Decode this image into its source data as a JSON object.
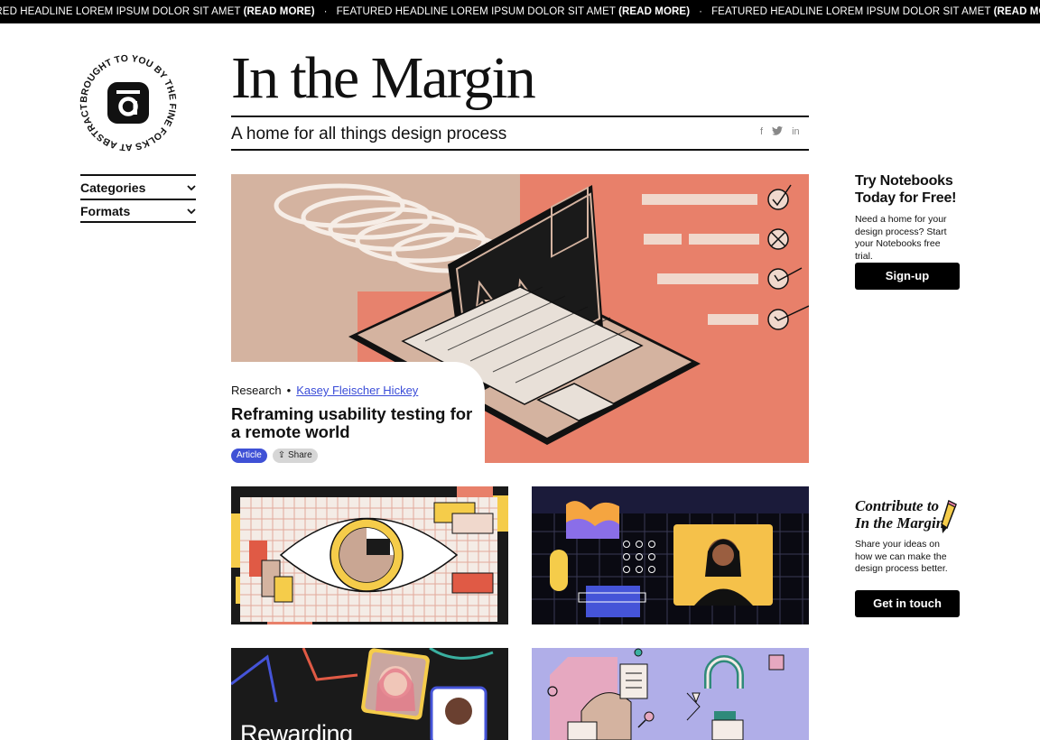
{
  "ticker": {
    "items": [
      {
        "text": "URED HEADLINE LOREM IPSUM DOLOR SIT AMET",
        "bold": "(READ MORE)"
      },
      {
        "text": "FEATURED HEADLINE LOREM IPSUM DOLOR SIT AMET",
        "bold": "(READ MORE)"
      },
      {
        "text": "FEATURED HEADLINE LOREM IPSUM DOLOR SIT AMET",
        "bold": "(READ MORE)"
      },
      {
        "text": "FEATURED HEAD",
        "bold": ""
      }
    ],
    "separator": "·"
  },
  "logo": {
    "ring_text": "BROUGHT TO YOU BY THE FINE FOLKS AT ABSTRACT"
  },
  "masthead": {
    "title": "In the Margin",
    "tagline": "A home for all things design process"
  },
  "social": [
    "f",
    "twitter-icon",
    "in"
  ],
  "side_menu": [
    {
      "label": "Categories"
    },
    {
      "label": "Formats"
    }
  ],
  "featured": {
    "category": "Research",
    "bullet": "•",
    "author": "Kasey Fleischer Hickey",
    "title": "Reframing usability testing for a remote world",
    "tag": "Article",
    "share": "Share"
  },
  "promo_notebooks": {
    "title": "Try Notebooks Today for Free!",
    "body": "Need a home for your design process? Start your Notebooks free trial.",
    "button": "Sign-up"
  },
  "promo_contribute": {
    "title_line1": "Contribute to",
    "title_line2": "In the Margin",
    "body": "Share your ideas on how we can make the design process better.",
    "button": "Get in touch"
  },
  "cards": [
    {
      "name": "eye-research-illustration"
    },
    {
      "name": "grid-portrait-illustration"
    },
    {
      "name": "rewarding-portraits-illustration",
      "overlay_text": "Rewarding"
    },
    {
      "name": "magnet-diagram-illustration"
    }
  ],
  "colors": {
    "accent": "#3f51d6",
    "hero_salmon": "#e8806a",
    "hero_tan": "#d4b3a0"
  }
}
